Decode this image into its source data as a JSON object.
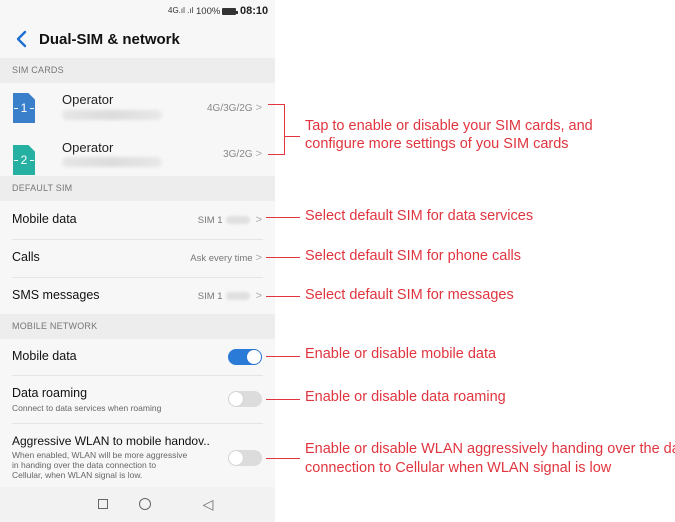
{
  "status_bar": {
    "signal": "4G.ıl .ıl",
    "battery_percent": "100%",
    "time": "08:10"
  },
  "header": {
    "back_icon": "chevron-left-icon",
    "title": "Dual-SIM & network"
  },
  "sections": {
    "sim_cards": "SIM CARDS",
    "default_sim": "DEFAULT SIM",
    "mobile_network": "MOBILE NETWORK"
  },
  "sim_cards": [
    {
      "slot": "1",
      "name": "Operator",
      "network": "4G/3G/2G",
      "color": "#3a7fc9"
    },
    {
      "slot": "2",
      "name": "Operator",
      "network": "3G/2G",
      "color": "#25b0a2"
    }
  ],
  "default_sim": {
    "mobile_data": {
      "label": "Mobile data",
      "value": "SIM 1"
    },
    "calls": {
      "label": "Calls",
      "value": "Ask every time"
    },
    "sms": {
      "label": "SMS messages",
      "value": "SIM 1"
    }
  },
  "mobile_network": {
    "mobile_data": {
      "label": "Mobile data",
      "on": true
    },
    "data_roaming": {
      "label": "Data roaming",
      "sub": "Connect to data services when roaming",
      "on": false
    },
    "aggressive_wlan": {
      "label": "Aggressive WLAN to mobile handov..",
      "sub_lines": [
        "When enabled, WLAN will be more aggressive",
        "in handing over the data connection to",
        "Cellular, when WLAN signal is low."
      ],
      "on": false
    }
  },
  "nav_bar": {
    "recent_icon": "square-icon",
    "home_icon": "circle-icon",
    "back_icon": "triangle-back-icon",
    "back_glyph": "◁"
  },
  "callouts": {
    "sim_cards_lines": [
      "Tap to enable or disable your SIM cards, and",
      "configure more settings of you SIM cards"
    ],
    "data_services": "Select default SIM for data services",
    "phone_calls": "Select default SIM for phone calls",
    "messages": "Select default SIM for messages",
    "mobile_data": "Enable or disable mobile data",
    "data_roaming": "Enable or disable data roaming",
    "wlan_lines": [
      "Enable or disable WLAN aggressively handing over the data",
      "connection to Cellular when WLAN signal is low"
    ]
  },
  "colors": {
    "accent": "#2a7ad8",
    "callout": "#e0353f",
    "section_bg": "#ededed"
  }
}
